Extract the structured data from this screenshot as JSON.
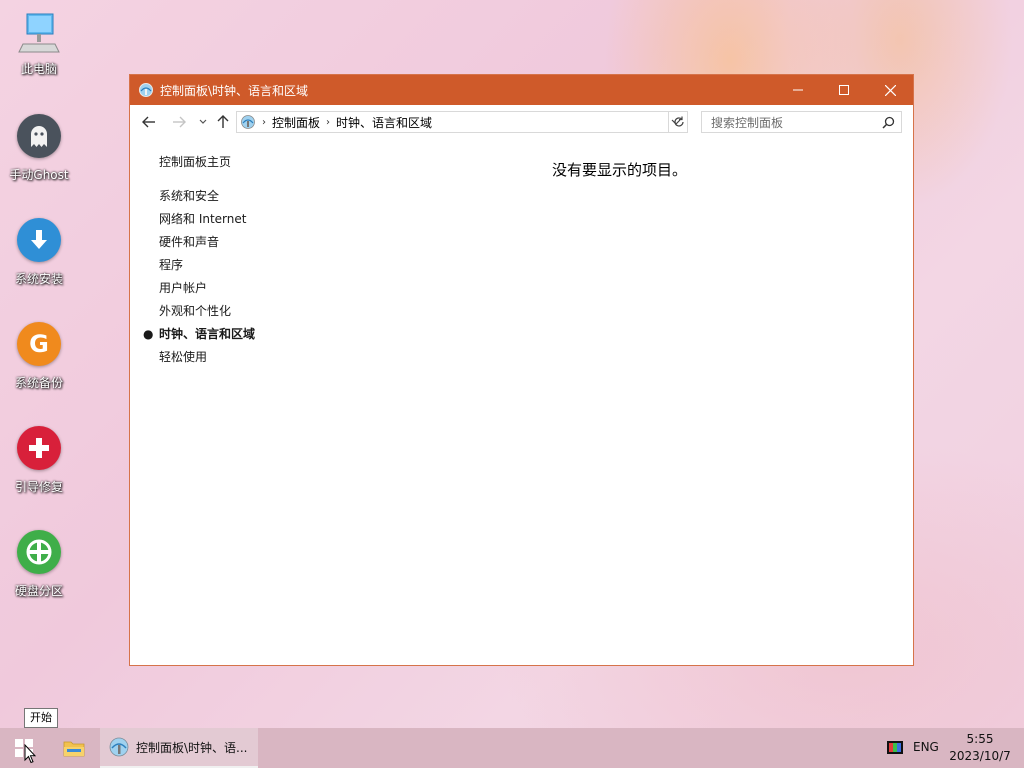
{
  "desktop": {
    "icons": [
      {
        "label": "此电脑",
        "icon": "computer-icon"
      },
      {
        "label": "手动Ghost",
        "icon": "ghost-icon"
      },
      {
        "label": "系统安装",
        "icon": "download-icon"
      },
      {
        "label": "系统备份",
        "icon": "g-letter-icon"
      },
      {
        "label": "引导修复",
        "icon": "plus-icon"
      },
      {
        "label": "硬盘分区",
        "icon": "partition-icon"
      }
    ]
  },
  "window": {
    "title": "控制面板\\时钟、语言和区域",
    "accent_color": "#cf5a2a",
    "address": {
      "crumbs": [
        "控制面板",
        "时钟、语言和区域"
      ]
    },
    "search_placeholder": "搜索控制面板",
    "sidebar": {
      "home": "控制面板主页",
      "items": [
        {
          "label": "系统和安全",
          "active": false
        },
        {
          "label": "网络和 Internet",
          "active": false
        },
        {
          "label": "硬件和声音",
          "active": false
        },
        {
          "label": "程序",
          "active": false
        },
        {
          "label": "用户帐户",
          "active": false
        },
        {
          "label": "外观和个性化",
          "active": false
        },
        {
          "label": "时钟、语言和区域",
          "active": true
        },
        {
          "label": "轻松使用",
          "active": false
        }
      ]
    },
    "empty_message": "没有要显示的项目。"
  },
  "tooltip": {
    "start": "开始"
  },
  "taskbar": {
    "task_label": "控制面板\\时钟、语...",
    "language": "ENG",
    "time": "5:55",
    "date": "2023/10/7"
  }
}
